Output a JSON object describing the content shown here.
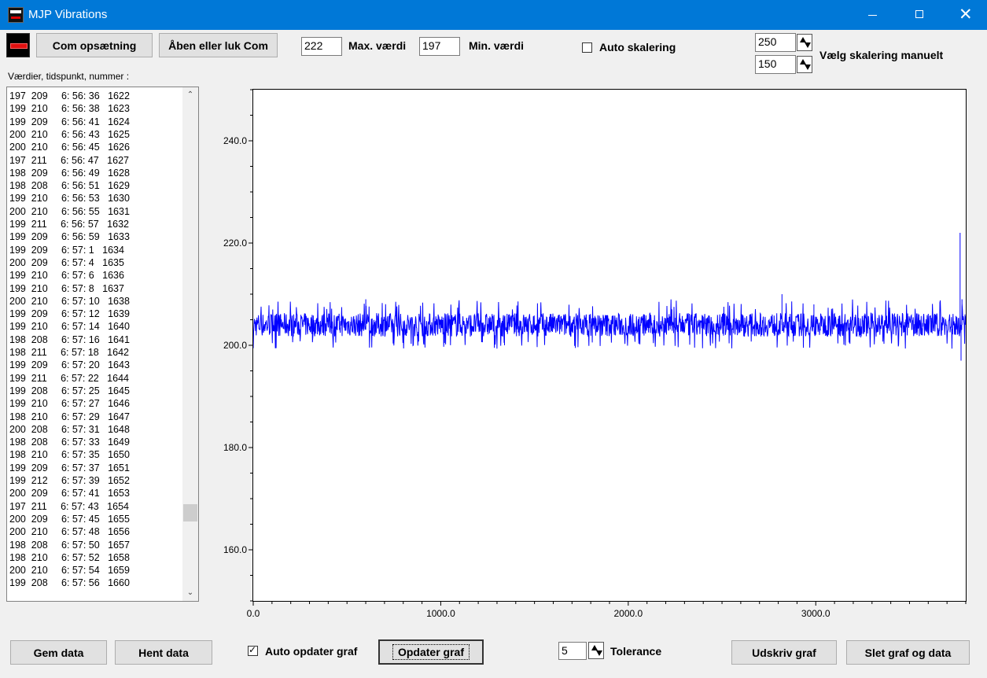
{
  "window": {
    "title": "MJP Vibrations"
  },
  "toolbar": {
    "com_setup": "Com opsætning",
    "open_close_com": "Åben eller luk Com",
    "max_value": "222",
    "max_label": "Max. værdi",
    "min_value": "197",
    "min_label": "Min. værdi",
    "auto_scale_label": "Auto skalering",
    "auto_scale_checked": false,
    "scale_upper": "250",
    "scale_lower": "150",
    "manual_scale_label": "Vælg skalering manuelt"
  },
  "list": {
    "header": "Værdier, tidspunkt, nummer :",
    "rows": [
      "197  209     6: 56: 36   1622",
      "199  210     6: 56: 38   1623",
      "199  209     6: 56: 41   1624",
      "200  210     6: 56: 43   1625",
      "200  210     6: 56: 45   1626",
      "197  211     6: 56: 47   1627",
      "198  209     6: 56: 49   1628",
      "198  208     6: 56: 51   1629",
      "199  210     6: 56: 53   1630",
      "200  210     6: 56: 55   1631",
      "199  211     6: 56: 57   1632",
      "199  209     6: 56: 59   1633",
      "199  209     6: 57: 1   1634",
      "200  209     6: 57: 4   1635",
      "199  210     6: 57: 6   1636",
      "199  210     6: 57: 8   1637",
      "200  210     6: 57: 10   1638",
      "199  209     6: 57: 12   1639",
      "199  210     6: 57: 14   1640",
      "198  208     6: 57: 16   1641",
      "198  211     6: 57: 18   1642",
      "199  209     6: 57: 20   1643",
      "199  211     6: 57: 22   1644",
      "199  208     6: 57: 25   1645",
      "199  210     6: 57: 27   1646",
      "198  210     6: 57: 29   1647",
      "200  208     6: 57: 31   1648",
      "198  208     6: 57: 33   1649",
      "198  210     6: 57: 35   1650",
      "199  209     6: 57: 37   1651",
      "199  212     6: 57: 39   1652",
      "200  209     6: 57: 41   1653",
      "197  211     6: 57: 43   1654",
      "200  209     6: 57: 45   1655",
      "200  210     6: 57: 48   1656",
      "198  208     6: 57: 50   1657",
      "198  210     6: 57: 52   1658",
      "200  210     6: 57: 54   1659",
      "199  208     6: 57: 56   1660"
    ]
  },
  "bottom": {
    "save_data": "Gem data",
    "load_data": "Hent data",
    "auto_update_label": "Auto opdater graf",
    "auto_update_checked": true,
    "update_graph": "Opdater graf",
    "tolerance_value": "5",
    "tolerance_label": "Tolerance",
    "print_graph": "Udskriv graf",
    "clear": "Slet graf og data"
  },
  "chart_data": {
    "type": "line",
    "color": "#0000ff",
    "xlim": [
      0,
      3800
    ],
    "ylim": [
      150,
      250
    ],
    "x_ticks": [
      "0.0",
      "1000.0",
      "2000.0",
      "3000.0"
    ],
    "y_ticks": [
      "160.0",
      "180.0",
      "200.0",
      "220.0",
      "240.0"
    ],
    "baseline": 204,
    "noise_band": [
      201,
      208
    ],
    "spikes": [
      {
        "x": 600,
        "y": 209
      },
      {
        "x": 1340,
        "y": 200
      },
      {
        "x": 2820,
        "y": 210
      },
      {
        "x": 2990,
        "y": 208
      },
      {
        "x": 3770,
        "y": 222
      },
      {
        "x": 3775,
        "y": 197
      },
      {
        "x": 3780,
        "y": 209
      }
    ]
  }
}
